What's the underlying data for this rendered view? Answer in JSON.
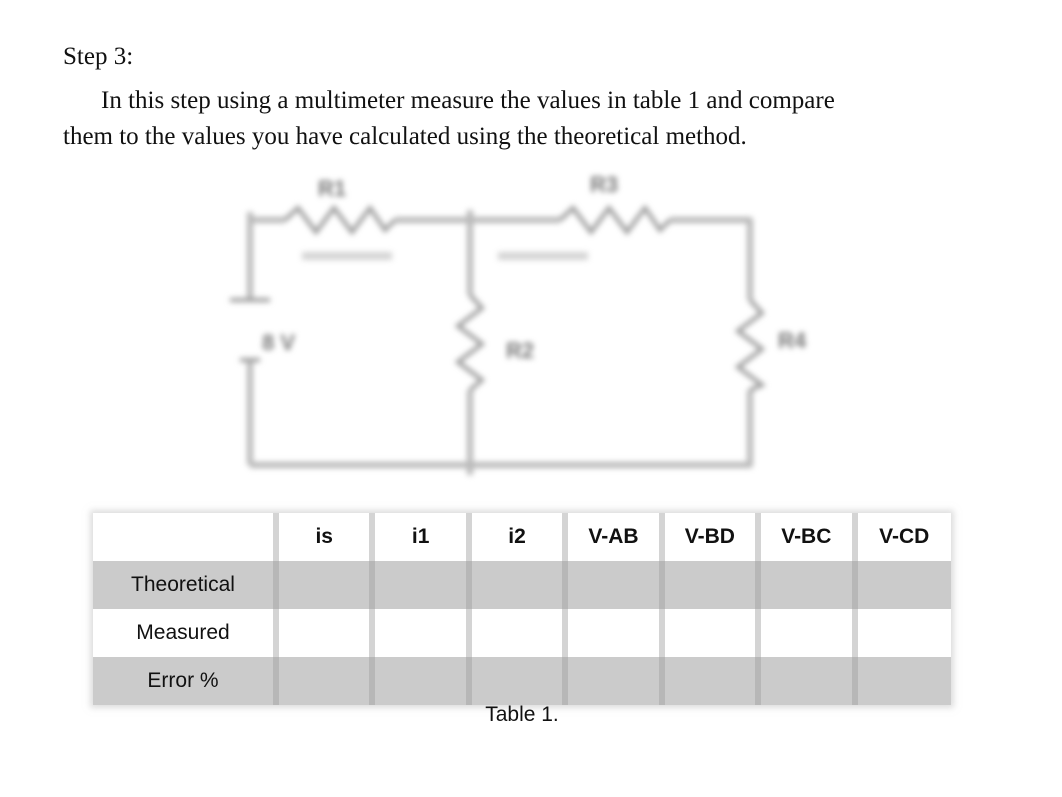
{
  "document": {
    "step_heading": "Step 3:",
    "paragraph_line1": "In this step  using a multimeter measure the values in table 1 and compare",
    "paragraph_line2": "them to the values you have calculated using the theoretical method."
  },
  "circuit": {
    "source_label": "8 V",
    "resistors": [
      {
        "id": "R1",
        "label": "R1"
      },
      {
        "id": "R2",
        "label": "R2"
      },
      {
        "id": "R3",
        "label": "R3"
      },
      {
        "id": "R4",
        "label": "R4"
      }
    ],
    "colors": {
      "wire": "#b8b8b8",
      "label": "#777777"
    }
  },
  "table": {
    "columns": [
      "",
      "is",
      "i1",
      "i2",
      "V-AB",
      "V-BD",
      "V-BC",
      "V-CD"
    ],
    "rows": [
      {
        "label": "Theoretical",
        "values": [
          "",
          "",
          "",
          "",
          "",
          "",
          ""
        ],
        "shaded": true
      },
      {
        "label": "Measured",
        "values": [
          "",
          "",
          "",
          "",
          "",
          "",
          ""
        ],
        "shaded": false
      },
      {
        "label": "Error %",
        "values": [
          "",
          "",
          "",
          "",
          "",
          "",
          ""
        ],
        "shaded": true
      }
    ],
    "caption": "Table 1.",
    "colors": {
      "shaded_row": "#cbcbcb",
      "header_row": "#ffffff"
    }
  }
}
